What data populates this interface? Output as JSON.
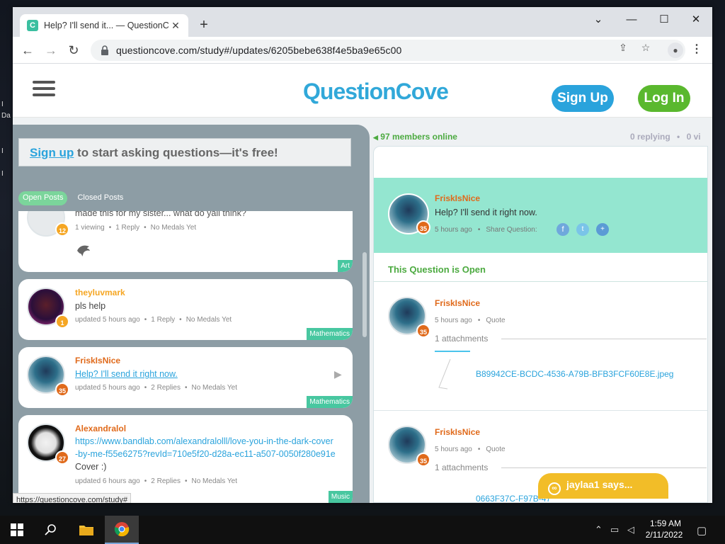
{
  "desktop": {
    "fragment_lines": [
      "I",
      "Da",
      "I",
      "I"
    ]
  },
  "browser": {
    "tab_title": "Help? I'll send it... — QuestionCo",
    "favicon_letter": "C",
    "tab_close": "✕",
    "new_tab": "+",
    "window_controls": {
      "dropdown": "⌄",
      "minimize": "—",
      "maximize": "☐",
      "close": "✕"
    },
    "nav": {
      "back": "←",
      "forward": "→",
      "reload": "↻"
    },
    "url": "questioncove.com/study#/updates/6205bebe638f4e5ba9e65c00",
    "status_url": "https://questioncove.com/study#"
  },
  "site": {
    "logo": {
      "part1": "Question",
      "part2": "Cove"
    },
    "signup_button": "Sign Up",
    "login_button": "Log In"
  },
  "sidebar": {
    "cta_link": "Sign up",
    "cta_rest": " to start asking questions—it's free!",
    "tabs": [
      {
        "label": "Open Posts",
        "active": true
      },
      {
        "label": "Closed Posts",
        "active": false
      }
    ],
    "posts": [
      {
        "user": "",
        "text": "made this for my sister... what do yall think?",
        "badge": "12",
        "meta_a": "1 viewing",
        "meta_b": "1 Reply",
        "meta_c": "No Medals Yet",
        "tag": "Art"
      },
      {
        "user": "theyluvmark",
        "text": "pls help",
        "badge": "1",
        "meta_a": "updated 5 hours ago",
        "meta_b": "1 Reply",
        "meta_c": "No Medals Yet",
        "tag": "Mathematics"
      },
      {
        "user": "FriskIsNice",
        "text": "Help? I'll send it right now.",
        "badge": "35",
        "meta_a": "updated 5 hours ago",
        "meta_b": "2 Replies",
        "meta_c": "No Medals Yet",
        "tag": "Mathematics"
      },
      {
        "user": "Alexandralol",
        "text": "https://www.bandlab.com/alexandralolll/love-you-in-the-dark-cover-by-me-f55e6275?revId=710e5f20-d28a-ec11-a507-0050f280e91e",
        "text_suffix": " Cover :)",
        "badge": "27",
        "meta_a": "updated 6 hours ago",
        "meta_b": "2 Replies",
        "meta_c": "No Medals Yet",
        "tag": "Music"
      }
    ]
  },
  "thread": {
    "members_online": "97 members online",
    "replying": "0 replying",
    "viewing": "0 vi",
    "question": {
      "user": "FriskIsNice",
      "text": "Help? I'll send it right now.",
      "time": "5 hours ago",
      "share_label": "Share Question:",
      "badge": "35"
    },
    "status": "This Question is Open",
    "replies": [
      {
        "user": "FriskIsNice",
        "time": "5 hours ago",
        "quote": "Quote",
        "attachments": "1 attachments",
        "file": "B89942CE-BCDC-4536-A79B-BFB3FCF60E8E.jpeg",
        "badge": "35"
      },
      {
        "user": "FriskIsNice",
        "time": "5 hours ago",
        "quote": "Quote",
        "attachments": "1 attachments",
        "file": "0663F37C-F97B-47",
        "badge": "35"
      }
    ]
  },
  "chat": {
    "label": "jaylaa1 says..."
  },
  "taskbar": {
    "time": "1:59 AM",
    "date": "2/11/2022"
  },
  "colors": {
    "accent_blue": "#2aa3dc",
    "green": "#5ab82e",
    "orange_user": "#e06a1b",
    "badge_orange": "#f5a623",
    "teal_header": "#94e6d0",
    "tag_teal": "#48c7a0"
  }
}
